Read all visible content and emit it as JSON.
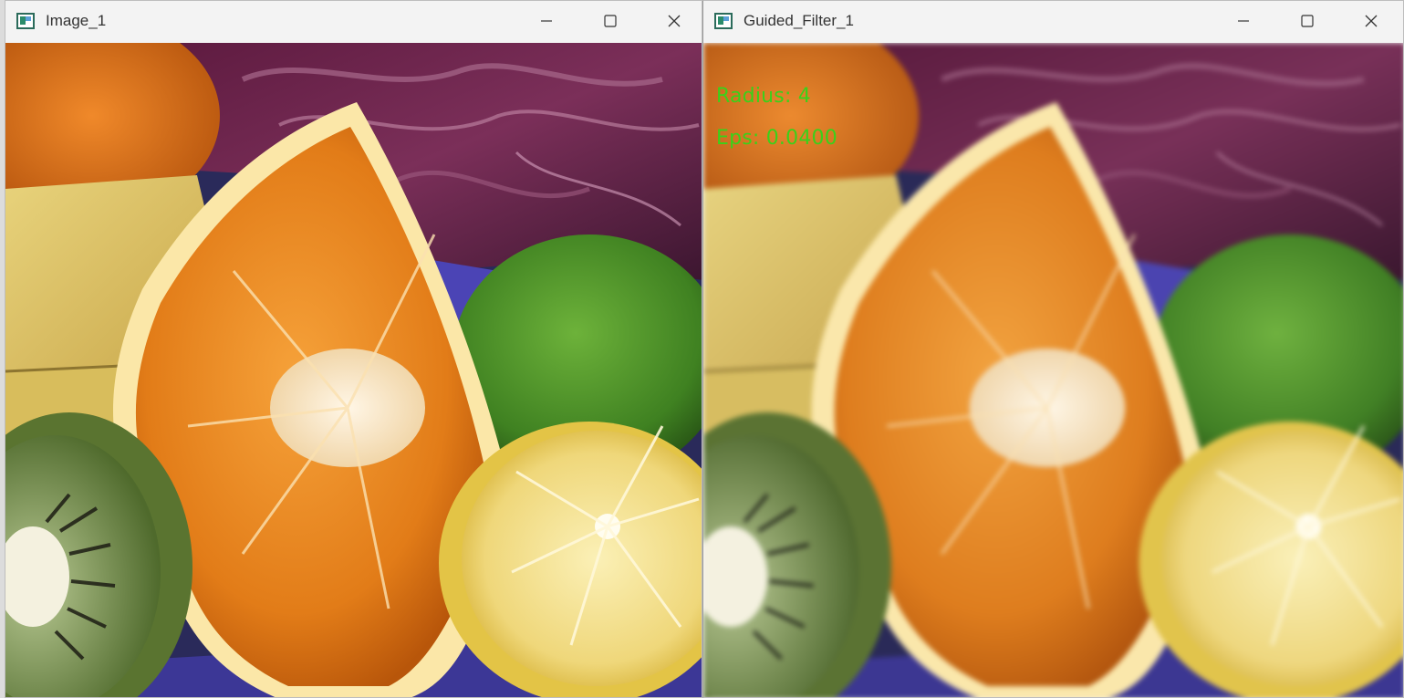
{
  "windows": [
    {
      "title": "Image_1"
    },
    {
      "title": "Guided_Filter_1"
    }
  ],
  "overlay": {
    "radius_text": "Radius: 4",
    "eps_text": "Eps: 0.0400"
  },
  "icons": {
    "app": "app-window-icon",
    "minimize": "minimize-icon",
    "maximize": "maximize-icon",
    "close": "close-icon"
  },
  "colors": {
    "overlay_text": "#3ad11a",
    "titlebar": "#f3f3f3"
  }
}
